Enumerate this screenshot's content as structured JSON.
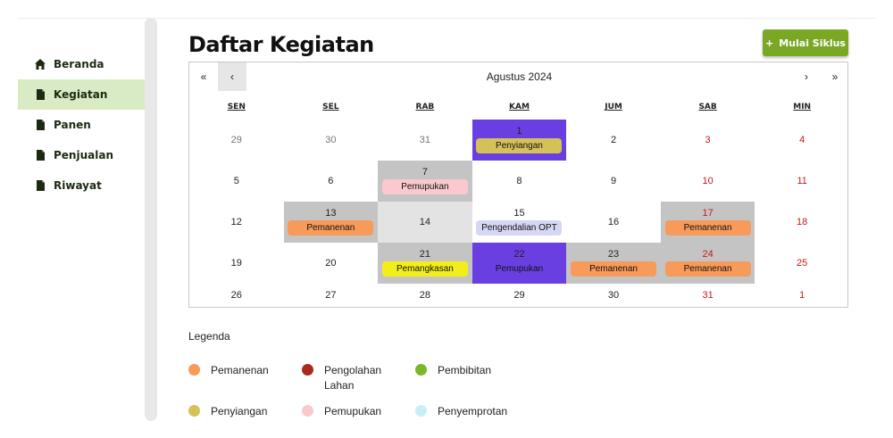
{
  "sidebar": {
    "items": [
      {
        "label": "Beranda",
        "icon": "home-icon",
        "active": false
      },
      {
        "label": "Kegiatan",
        "icon": "document-icon",
        "active": true
      },
      {
        "label": "Panen",
        "icon": "document-icon",
        "active": false
      },
      {
        "label": "Penjualan",
        "icon": "document-icon",
        "active": false
      },
      {
        "label": "Riwayat",
        "icon": "document-icon",
        "active": false
      }
    ]
  },
  "header": {
    "title": "Daftar Kegiatan",
    "start_button": "Mulai Siklus",
    "start_button_icon": "plus-icon"
  },
  "calendar": {
    "nav": {
      "prev_year": "«",
      "prev": "‹",
      "next": "›",
      "next_year": "»"
    },
    "month": "Agustus 2024",
    "days_of_week": [
      "SEN",
      "SEL",
      "RAB",
      "KAM",
      "JUM",
      "SAB",
      "MIN"
    ],
    "weeks": [
      [
        {
          "day": "29",
          "muted": true
        },
        {
          "day": "30",
          "muted": true
        },
        {
          "day": "31",
          "muted": true
        },
        {
          "day": "1",
          "bg": "purple",
          "event": "Penyiangan",
          "event_color": "#d4c157"
        },
        {
          "day": "2"
        },
        {
          "day": "3",
          "weekend": true
        },
        {
          "day": "4",
          "weekend": true
        }
      ],
      [
        {
          "day": "5"
        },
        {
          "day": "6"
        },
        {
          "day": "7",
          "bg": "gray",
          "event": "Pemupukan",
          "event_color": "#f9c9cd"
        },
        {
          "day": "8"
        },
        {
          "day": "9"
        },
        {
          "day": "10",
          "weekend": true
        },
        {
          "day": "11",
          "weekend": true
        }
      ],
      [
        {
          "day": "12"
        },
        {
          "day": "13",
          "bg": "gray",
          "event": "Pemanenan",
          "event_color": "#f79a5a"
        },
        {
          "day": "14",
          "bg": "light"
        },
        {
          "day": "15",
          "event": "Pengendalian OPT",
          "event_color": "#d6d6f5"
        },
        {
          "day": "16"
        },
        {
          "day": "17",
          "weekend": true,
          "bg": "gray",
          "event": "Pemanenan",
          "event_color": "#f79a5a"
        },
        {
          "day": "18",
          "weekend": true
        }
      ],
      [
        {
          "day": "19"
        },
        {
          "day": "20"
        },
        {
          "day": "21",
          "bg": "gray",
          "event": "Pemangkasan",
          "event_color": "#f3ee1a"
        },
        {
          "day": "22",
          "bg": "purple",
          "event": "Pemupukan",
          "event_color": "transparent"
        },
        {
          "day": "23",
          "bg": "gray",
          "event": "Pemanenan",
          "event_color": "#f79a5a"
        },
        {
          "day": "24",
          "weekend": true,
          "bg": "gray",
          "event": "Pemanenan",
          "event_color": "#f79a5a"
        },
        {
          "day": "25",
          "weekend": true
        }
      ],
      [
        {
          "day": "26"
        },
        {
          "day": "27"
        },
        {
          "day": "28"
        },
        {
          "day": "29"
        },
        {
          "day": "30"
        },
        {
          "day": "31",
          "weekend": true
        },
        {
          "day": "1",
          "muted": true,
          "weekend": true
        }
      ]
    ]
  },
  "legend": {
    "title": "Legenda",
    "items": [
      {
        "label": "Pemanenan",
        "color": "#f79a5a"
      },
      {
        "label": "Pengolahan Lahan",
        "color": "#a82a1e"
      },
      {
        "label": "Pembibitan",
        "color": "#7ab82a"
      },
      {
        "label": "Penyiangan",
        "color": "#d4c157"
      },
      {
        "label": "Pemupukan",
        "color": "#f9c9cd"
      },
      {
        "label": "Penyemprotan",
        "color": "#c9eef7"
      }
    ]
  },
  "colors": {
    "accent": "#7aa825",
    "sidebar_active": "#d9ebc4",
    "highlight_purple": "#6a3fe2",
    "highlight_gray": "#c4c4c4",
    "weekend_text": "#c41a1a"
  }
}
